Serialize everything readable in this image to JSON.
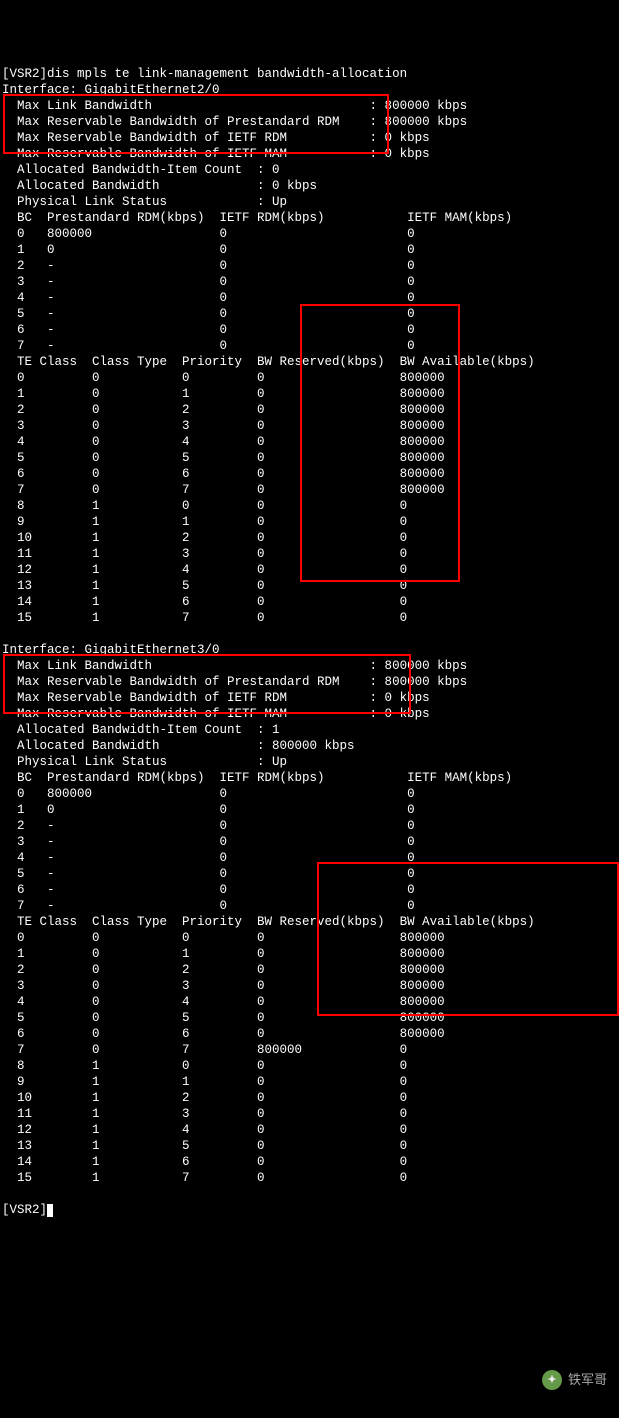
{
  "prompt_line": "[VSR2]dis mpls te link-management bandwidth-allocation",
  "end_prompt": "[VSR2]",
  "watermark_text": "铁军哥",
  "interfaces": [
    {
      "name": "GigabitEthernet2/0",
      "max_link_bw": "800000 kbps",
      "max_res_pre_rdm": "800000 kbps",
      "max_res_ietf_rdm": "0 kbps",
      "max_res_ietf_mam": "0 kbps",
      "alloc_item_count": "0",
      "alloc_bw": "0 kbps",
      "phys_link_status": "Up",
      "bc_header": [
        "BC",
        "Prestandard RDM(kbps)",
        "IETF RDM(kbps)",
        "IETF MAM(kbps)"
      ],
      "bc_rows": [
        [
          "0",
          "800000",
          "0",
          "0"
        ],
        [
          "1",
          "0",
          "0",
          "0"
        ],
        [
          "2",
          "-",
          "0",
          "0"
        ],
        [
          "3",
          "-",
          "0",
          "0"
        ],
        [
          "4",
          "-",
          "0",
          "0"
        ],
        [
          "5",
          "-",
          "0",
          "0"
        ],
        [
          "6",
          "-",
          "0",
          "0"
        ],
        [
          "7",
          "-",
          "0",
          "0"
        ]
      ],
      "te_header": [
        "TE Class",
        "Class Type",
        "Priority",
        "BW Reserved(kbps)",
        "BW Available(kbps)"
      ],
      "te_rows": [
        [
          "0",
          "0",
          "0",
          "0",
          "800000"
        ],
        [
          "1",
          "0",
          "1",
          "0",
          "800000"
        ],
        [
          "2",
          "0",
          "2",
          "0",
          "800000"
        ],
        [
          "3",
          "0",
          "3",
          "0",
          "800000"
        ],
        [
          "4",
          "0",
          "4",
          "0",
          "800000"
        ],
        [
          "5",
          "0",
          "5",
          "0",
          "800000"
        ],
        [
          "6",
          "0",
          "6",
          "0",
          "800000"
        ],
        [
          "7",
          "0",
          "7",
          "0",
          "800000"
        ],
        [
          "8",
          "1",
          "0",
          "0",
          "0"
        ],
        [
          "9",
          "1",
          "1",
          "0",
          "0"
        ],
        [
          "10",
          "1",
          "2",
          "0",
          "0"
        ],
        [
          "11",
          "1",
          "3",
          "0",
          "0"
        ],
        [
          "12",
          "1",
          "4",
          "0",
          "0"
        ],
        [
          "13",
          "1",
          "5",
          "0",
          "0"
        ],
        [
          "14",
          "1",
          "6",
          "0",
          "0"
        ],
        [
          "15",
          "1",
          "7",
          "0",
          "0"
        ]
      ]
    },
    {
      "name": "GigabitEthernet3/0",
      "max_link_bw": "800000 kbps",
      "max_res_pre_rdm": "800000 kbps",
      "max_res_ietf_rdm": "0 kbps",
      "max_res_ietf_mam": "0 kbps",
      "alloc_item_count": "1",
      "alloc_bw": "800000 kbps",
      "phys_link_status": "Up",
      "bc_header": [
        "BC",
        "Prestandard RDM(kbps)",
        "IETF RDM(kbps)",
        "IETF MAM(kbps)"
      ],
      "bc_rows": [
        [
          "0",
          "800000",
          "0",
          "0"
        ],
        [
          "1",
          "0",
          "0",
          "0"
        ],
        [
          "2",
          "-",
          "0",
          "0"
        ],
        [
          "3",
          "-",
          "0",
          "0"
        ],
        [
          "4",
          "-",
          "0",
          "0"
        ],
        [
          "5",
          "-",
          "0",
          "0"
        ],
        [
          "6",
          "-",
          "0",
          "0"
        ],
        [
          "7",
          "-",
          "0",
          "0"
        ]
      ],
      "te_header": [
        "TE Class",
        "Class Type",
        "Priority",
        "BW Reserved(kbps)",
        "BW Available(kbps)"
      ],
      "te_rows": [
        [
          "0",
          "0",
          "0",
          "0",
          "800000"
        ],
        [
          "1",
          "0",
          "1",
          "0",
          "800000"
        ],
        [
          "2",
          "0",
          "2",
          "0",
          "800000"
        ],
        [
          "3",
          "0",
          "3",
          "0",
          "800000"
        ],
        [
          "4",
          "0",
          "4",
          "0",
          "800000"
        ],
        [
          "5",
          "0",
          "5",
          "0",
          "800000"
        ],
        [
          "6",
          "0",
          "6",
          "0",
          "800000"
        ],
        [
          "7",
          "0",
          "7",
          "800000",
          "0"
        ],
        [
          "8",
          "1",
          "0",
          "0",
          "0"
        ],
        [
          "9",
          "1",
          "1",
          "0",
          "0"
        ],
        [
          "10",
          "1",
          "2",
          "0",
          "0"
        ],
        [
          "11",
          "1",
          "3",
          "0",
          "0"
        ],
        [
          "12",
          "1",
          "4",
          "0",
          "0"
        ],
        [
          "13",
          "1",
          "5",
          "0",
          "0"
        ],
        [
          "14",
          "1",
          "6",
          "0",
          "0"
        ],
        [
          "15",
          "1",
          "7",
          "0",
          "0"
        ]
      ]
    }
  ],
  "labels": {
    "interface": "Interface: ",
    "max_link_bw": "  Max Link Bandwidth",
    "max_res_pre": "  Max Reservable Bandwidth of Prestandard RDM",
    "max_res_ietf_rdm": "  Max Reservable Bandwidth of IETF RDM",
    "max_res_ietf_mam": "  Max Reservable Bandwidth of IETF MAM",
    "alloc_item": "  Allocated Bandwidth-Item Count",
    "alloc_bw": "  Allocated Bandwidth",
    "phys_link": "  Physical Link Status"
  }
}
